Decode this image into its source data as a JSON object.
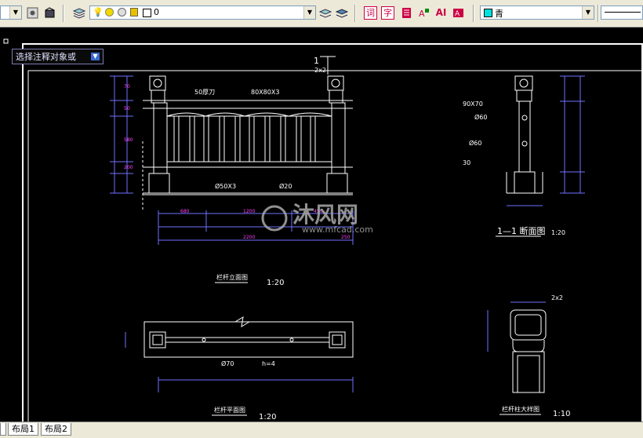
{
  "toolbar": {
    "layer_value": "0",
    "color_value": "青",
    "text_button": "词",
    "char_button": "字",
    "ai_button": "AI"
  },
  "tooltip": {
    "text": "选择注释对象或"
  },
  "drawing": {
    "section_mark": "1",
    "label_2x2_top": "2x2",
    "label_2x2_detail": "2x2",
    "label_50pipe": "50厚刀",
    "label_rail": "80X80X3",
    "label_pipe_left": "Ø50X3",
    "label_pipe_right": "Ø20",
    "label_90x70": "90X70",
    "label_d60a": "Ø60",
    "label_d60b": "Ø60",
    "label_30": "30",
    "label_section_title": "1—1 断面图",
    "label_section_scale": "1:20",
    "label_elev_title": "栏杆立面图",
    "label_elev_scale": "1:20",
    "label_plan_title": "栏杆平面图",
    "label_plan_scale": "1:20",
    "label_detail_title": "栏杆柱大样图",
    "label_detail_scale": "1:10",
    "label_plan_note": "Ø70",
    "label_plan_note2": "h=4",
    "watermark_name": "沐风网",
    "watermark_url": "www.mfcad.com"
  },
  "tabs": [
    {
      "label": "布局1"
    },
    {
      "label": "布局2"
    }
  ]
}
